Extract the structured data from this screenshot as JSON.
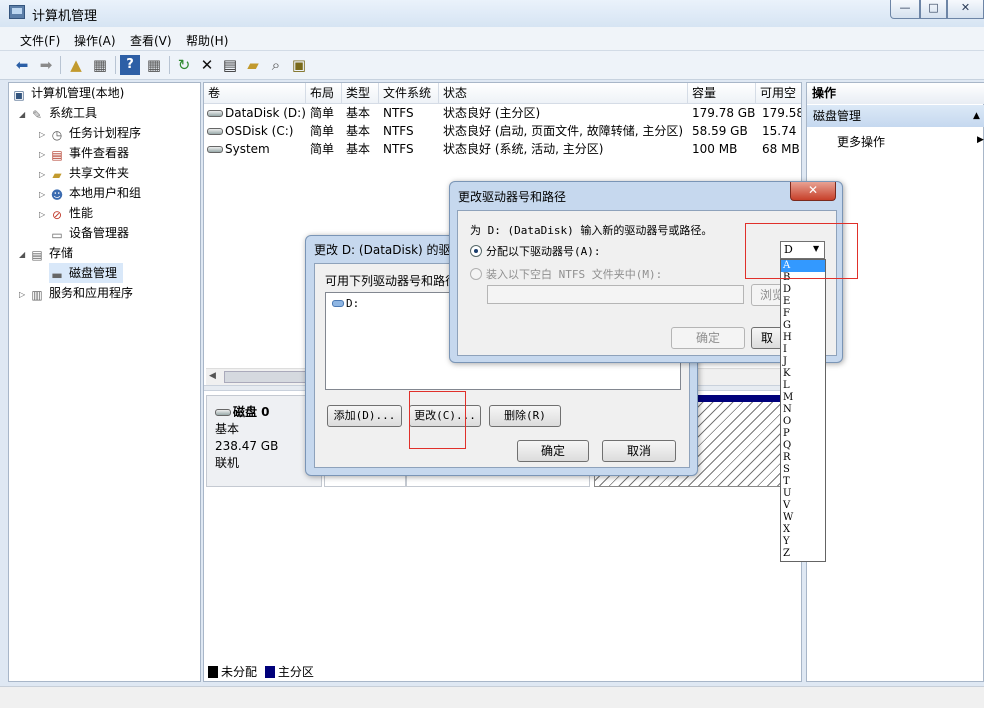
{
  "window": {
    "title": "计算机管理"
  },
  "window_controls": {
    "minimize": "—",
    "maximize": "□",
    "close": "✕"
  },
  "menu": [
    "文件(F)",
    "操作(A)",
    "查看(V)",
    "帮助(H)"
  ],
  "tree": {
    "root": "计算机管理(本地)",
    "system_tools": "系统工具",
    "task_scheduler": "任务计划程序",
    "event_viewer": "事件查看器",
    "shared_folders": "共享文件夹",
    "local_users": "本地用户和组",
    "performance": "性能",
    "device_manager": "设备管理器",
    "storage": "存储",
    "disk_management": "磁盘管理",
    "services_apps": "服务和应用程序"
  },
  "volumes": {
    "columns": [
      "卷",
      "布局",
      "类型",
      "文件系统",
      "状态",
      "容量",
      "可用空"
    ],
    "rows": [
      [
        "DataDisk (D:)",
        "简单",
        "基本",
        "NTFS",
        "状态良好 (主分区)",
        "179.78 GB",
        "179.58"
      ],
      [
        "OSDisk (C:)",
        "简单",
        "基本",
        "NTFS",
        "状态良好 (启动, 页面文件, 故障转储, 主分区)",
        "58.59 GB",
        "15.74"
      ],
      [
        "System",
        "简单",
        "基本",
        "NTFS",
        "状态良好 (系统, 活动, 主分区)",
        "100 MB",
        "68 MB"
      ]
    ]
  },
  "disk0": {
    "name": "磁盘 0",
    "type": "基本",
    "size": "238.47 GB",
    "state": "联机"
  },
  "legend": {
    "unallocated": "未分配",
    "primary": "主分区"
  },
  "actions": {
    "header": "操作",
    "section": "磁盘管理",
    "more": "更多操作",
    "expand_icon": "▲",
    "more_arrow": "▶"
  },
  "dialog_back": {
    "title": "更改 D: (DataDisk) 的驱动",
    "list_label": "可用下列驱动器号和路径",
    "list_item": "D:",
    "add": "添加(D)...",
    "change": "更改(C)...",
    "delete": "删除(R)",
    "ok": "确定",
    "cancel": "取消"
  },
  "dialog_front": {
    "title": "更改驱动器号和路径",
    "close": "✕",
    "prompt": "为 D: (DataDisk) 输入新的驱动器号或路径。",
    "assign_letter": "分配以下驱动器号(A):",
    "mount_folder": "装入以下空白 NTFS 文件夹中(M):",
    "browse": "浏览",
    "ok": "确定",
    "cancel": "取"
  },
  "drive_combo": {
    "value": "D",
    "arrow": "▼"
  },
  "drive_letters": [
    "A",
    "B",
    "D",
    "E",
    "F",
    "G",
    "H",
    "I",
    "J",
    "K",
    "L",
    "M",
    "N",
    "O",
    "P",
    "Q",
    "R",
    "S",
    "T",
    "U",
    "V",
    "W",
    "X",
    "Y",
    "Z"
  ],
  "colors": {
    "selection": "#3399ff",
    "annotation": "#e0302a",
    "primary_partition": "#00007a"
  }
}
